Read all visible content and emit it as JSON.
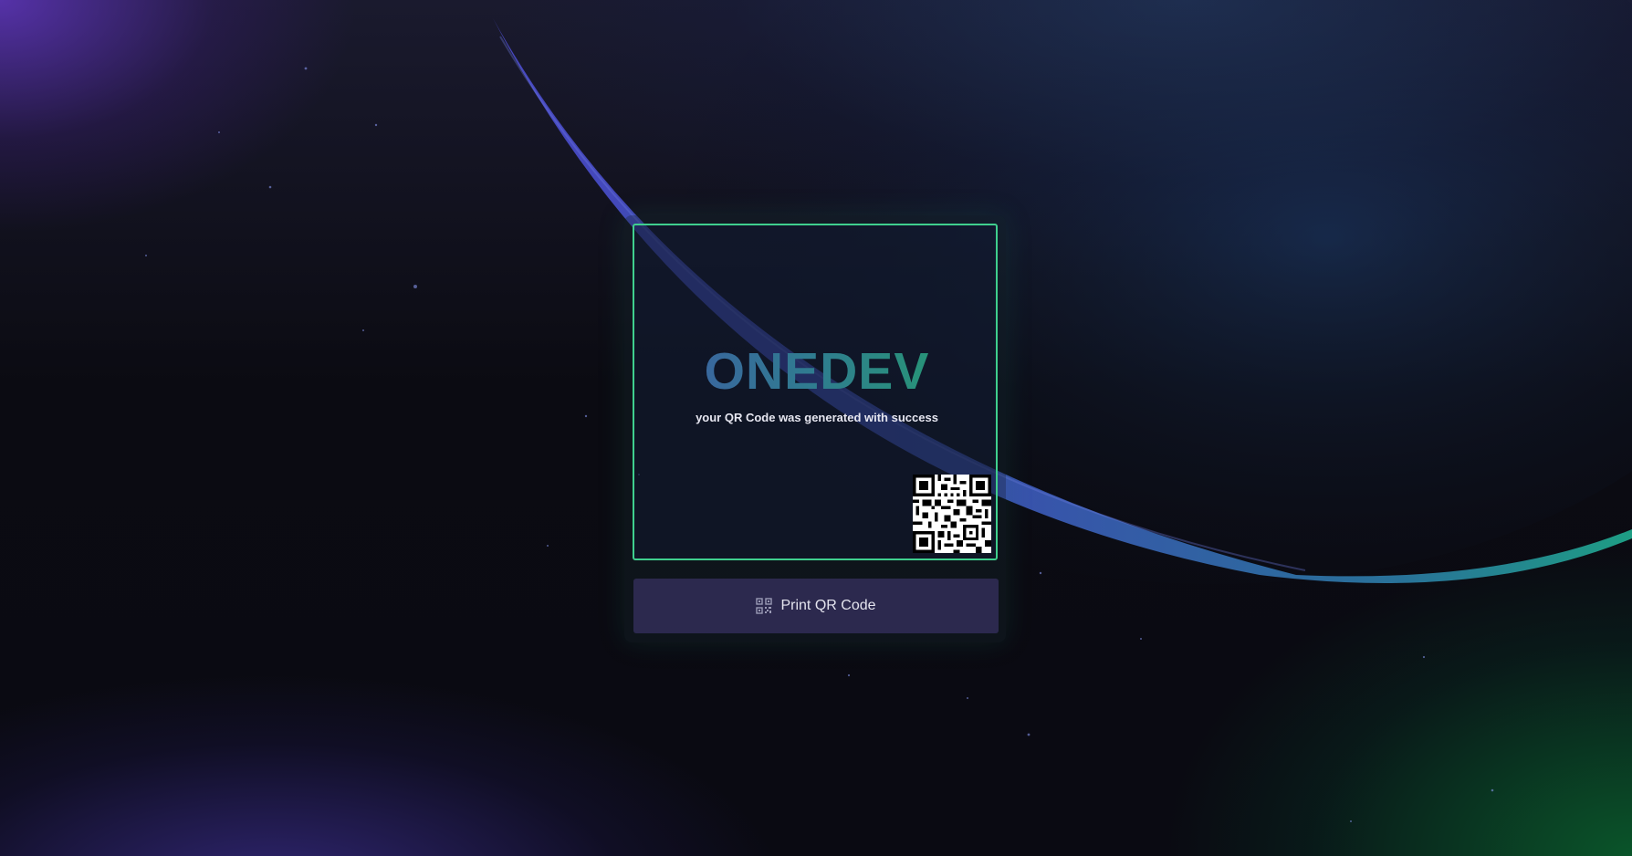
{
  "brand": {
    "name": "ONEDEV",
    "gradient_colors": [
      "#3f5aa6",
      "#2f7d8f",
      "#23a06a"
    ]
  },
  "message": "your QR Code was generated with success",
  "print_button": {
    "label": "Print QR Code",
    "icon": "qr-code-icon"
  },
  "colors": {
    "panel_border": "#3fcf8e",
    "button_background": "#34305c",
    "moon_arc": "#3b4fb8",
    "moon_arc_end": "#1f8f86"
  }
}
